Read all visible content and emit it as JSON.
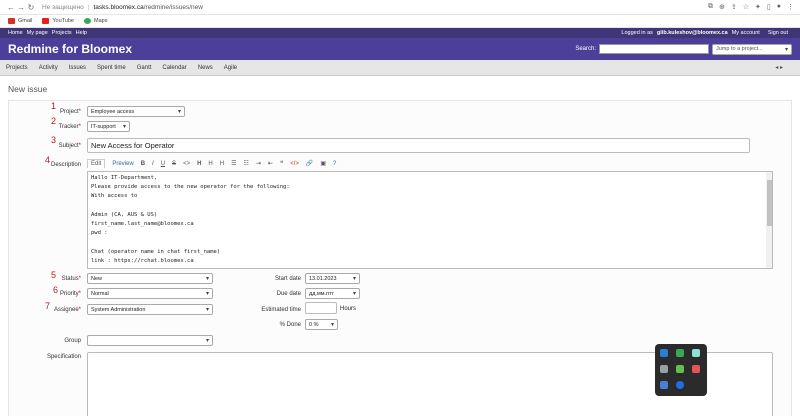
{
  "browser": {
    "security_warning": "Не защищено",
    "url_host": "tasks.bloomex.ca",
    "url_path": "/redmine/issues/new",
    "bookmarks": [
      {
        "label": "Gmail",
        "color": "#d93025"
      },
      {
        "label": "YouTube",
        "color": "#e62117"
      },
      {
        "label": "Maps",
        "color": "#34a853"
      }
    ]
  },
  "top_menu": {
    "items": [
      "Home",
      "My page",
      "Projects",
      "Help"
    ],
    "logged_prefix": "Logged in as",
    "user": "glib.kuleshov@bloomex.ca",
    "my_account": "My account",
    "sign_out": "Sign out"
  },
  "header": {
    "title": "Redmine for Bloomex",
    "search_label": "Search:",
    "jump_placeholder": "Jump to a project..."
  },
  "main_menu": [
    "Projects",
    "Activity",
    "Issues",
    "Spent time",
    "Gantt",
    "Calendar",
    "News",
    "Agile"
  ],
  "page_title": "New issue",
  "form": {
    "project": {
      "label": "Project",
      "value": "Employee access",
      "marker": "1"
    },
    "tracker": {
      "label": "Tracker",
      "value": "IT-support",
      "marker": "2"
    },
    "subject": {
      "label": "Subject",
      "value": "New Access for Operator",
      "marker": "3"
    },
    "description": {
      "label": "Description",
      "marker": "4",
      "tab_edit": "Edit",
      "tab_preview": "Preview",
      "text": "Hallo IT-Department,\nPlease provide access to the new operator for the following:\nWith access to\n\nAdmin (CA, AUS & US)\nfirst_name.last_name@bloomex.ca\npwd :\n\nChat (operator name in chat first_name)\nlink : https://rchat.bloomex.ca"
    },
    "status": {
      "label": "Status",
      "value": "New",
      "marker": "5"
    },
    "priority": {
      "label": "Priority",
      "value": "Normal",
      "marker": "6"
    },
    "assignee": {
      "label": "Assignee",
      "value": "System Administration",
      "marker": "7"
    },
    "group": {
      "label": "Group",
      "value": ""
    },
    "specification": {
      "label": "Specification"
    },
    "start_date": {
      "label": "Start date",
      "value": "13.01.2023"
    },
    "due_date": {
      "label": "Due date",
      "value": "дд.мм.гггг"
    },
    "estimated_time": {
      "label": "Estimated time",
      "unit": "Hours"
    },
    "done": {
      "label": "% Done",
      "value": "0 %"
    }
  }
}
